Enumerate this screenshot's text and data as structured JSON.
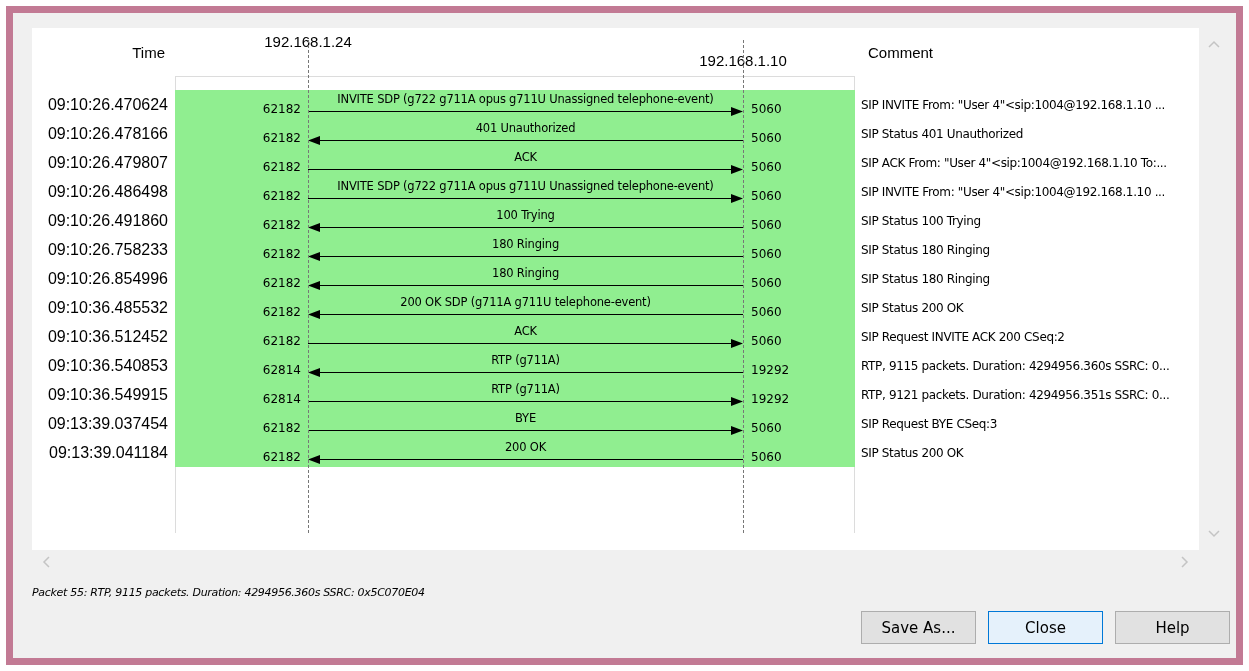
{
  "diagram": {
    "time_header": "Time",
    "comment_header": "Comment",
    "hosts": [
      "192.168.1.24",
      "192.168.1.10"
    ],
    "messages": [
      {
        "time": "09:10:26.470624",
        "left_port": "62182",
        "label": "INVITE SDP (g722 g711A opus g711U Unassigned telephone-event)",
        "kind": "rightward",
        "right_port": "5060",
        "comment": "SIP INVITE From: \"User 4\"<sip:1004@192.168.1.10 ..."
      },
      {
        "time": "09:10:26.478166",
        "left_port": "62182",
        "label": "401 Unauthorized",
        "kind": "leftward",
        "right_port": "5060",
        "comment": "SIP Status 401 Unauthorized"
      },
      {
        "time": "09:10:26.479807",
        "left_port": "62182",
        "label": "ACK",
        "kind": "rightward",
        "right_port": "5060",
        "comment": "SIP ACK From: \"User 4\"<sip:1004@192.168.1.10 To:..."
      },
      {
        "time": "09:10:26.486498",
        "left_port": "62182",
        "label": "INVITE SDP (g722 g711A opus g711U Unassigned telephone-event)",
        "kind": "rightward",
        "right_port": "5060",
        "comment": "SIP INVITE From: \"User 4\"<sip:1004@192.168.1.10 ..."
      },
      {
        "time": "09:10:26.491860",
        "left_port": "62182",
        "label": "100 Trying",
        "kind": "leftward",
        "right_port": "5060",
        "comment": "SIP Status 100 Trying"
      },
      {
        "time": "09:10:26.758233",
        "left_port": "62182",
        "label": "180 Ringing",
        "kind": "leftward",
        "right_port": "5060",
        "comment": "SIP Status 180 Ringing"
      },
      {
        "time": "09:10:26.854996",
        "left_port": "62182",
        "label": "180 Ringing",
        "kind": "leftward",
        "right_port": "5060",
        "comment": "SIP Status 180 Ringing"
      },
      {
        "time": "09:10:36.485532",
        "left_port": "62182",
        "label": "200 OK SDP (g711A g711U telephone-event)",
        "kind": "leftward",
        "right_port": "5060",
        "comment": "SIP Status 200 OK"
      },
      {
        "time": "09:10:36.512452",
        "left_port": "62182",
        "label": "ACK",
        "kind": "rightward",
        "right_port": "5060",
        "comment": "SIP Request INVITE ACK 200 CSeq:2"
      },
      {
        "time": "09:10:36.540853",
        "left_port": "62814",
        "label": "RTP (g711A)",
        "kind": "leftward",
        "right_port": "19292",
        "comment": "RTP, 9115 packets. Duration: 4294956.360s SSRC: 0..."
      },
      {
        "time": "09:10:36.549915",
        "left_port": "62814",
        "label": "RTP (g711A)",
        "kind": "rightward",
        "right_port": "19292",
        "comment": "RTP, 9121 packets. Duration: 4294956.351s SSRC: 0..."
      },
      {
        "time": "09:13:39.037454",
        "left_port": "62182",
        "label": "BYE",
        "kind": "rightward",
        "right_port": "5060",
        "comment": "SIP Request BYE CSeq:3"
      },
      {
        "time": "09:13:39.041184",
        "left_port": "62182",
        "label": "200 OK",
        "kind": "leftward",
        "right_port": "5060",
        "comment": "SIP Status 200 OK"
      }
    ]
  },
  "status": "Packet 55: RTP, 9115 packets. Duration: 4294956.360s SSRC: 0x5C070E04",
  "buttons": [
    {
      "label": "Save As...",
      "focused": false
    },
    {
      "label": "Close",
      "focused": true
    },
    {
      "label": "Help",
      "focused": false
    }
  ]
}
